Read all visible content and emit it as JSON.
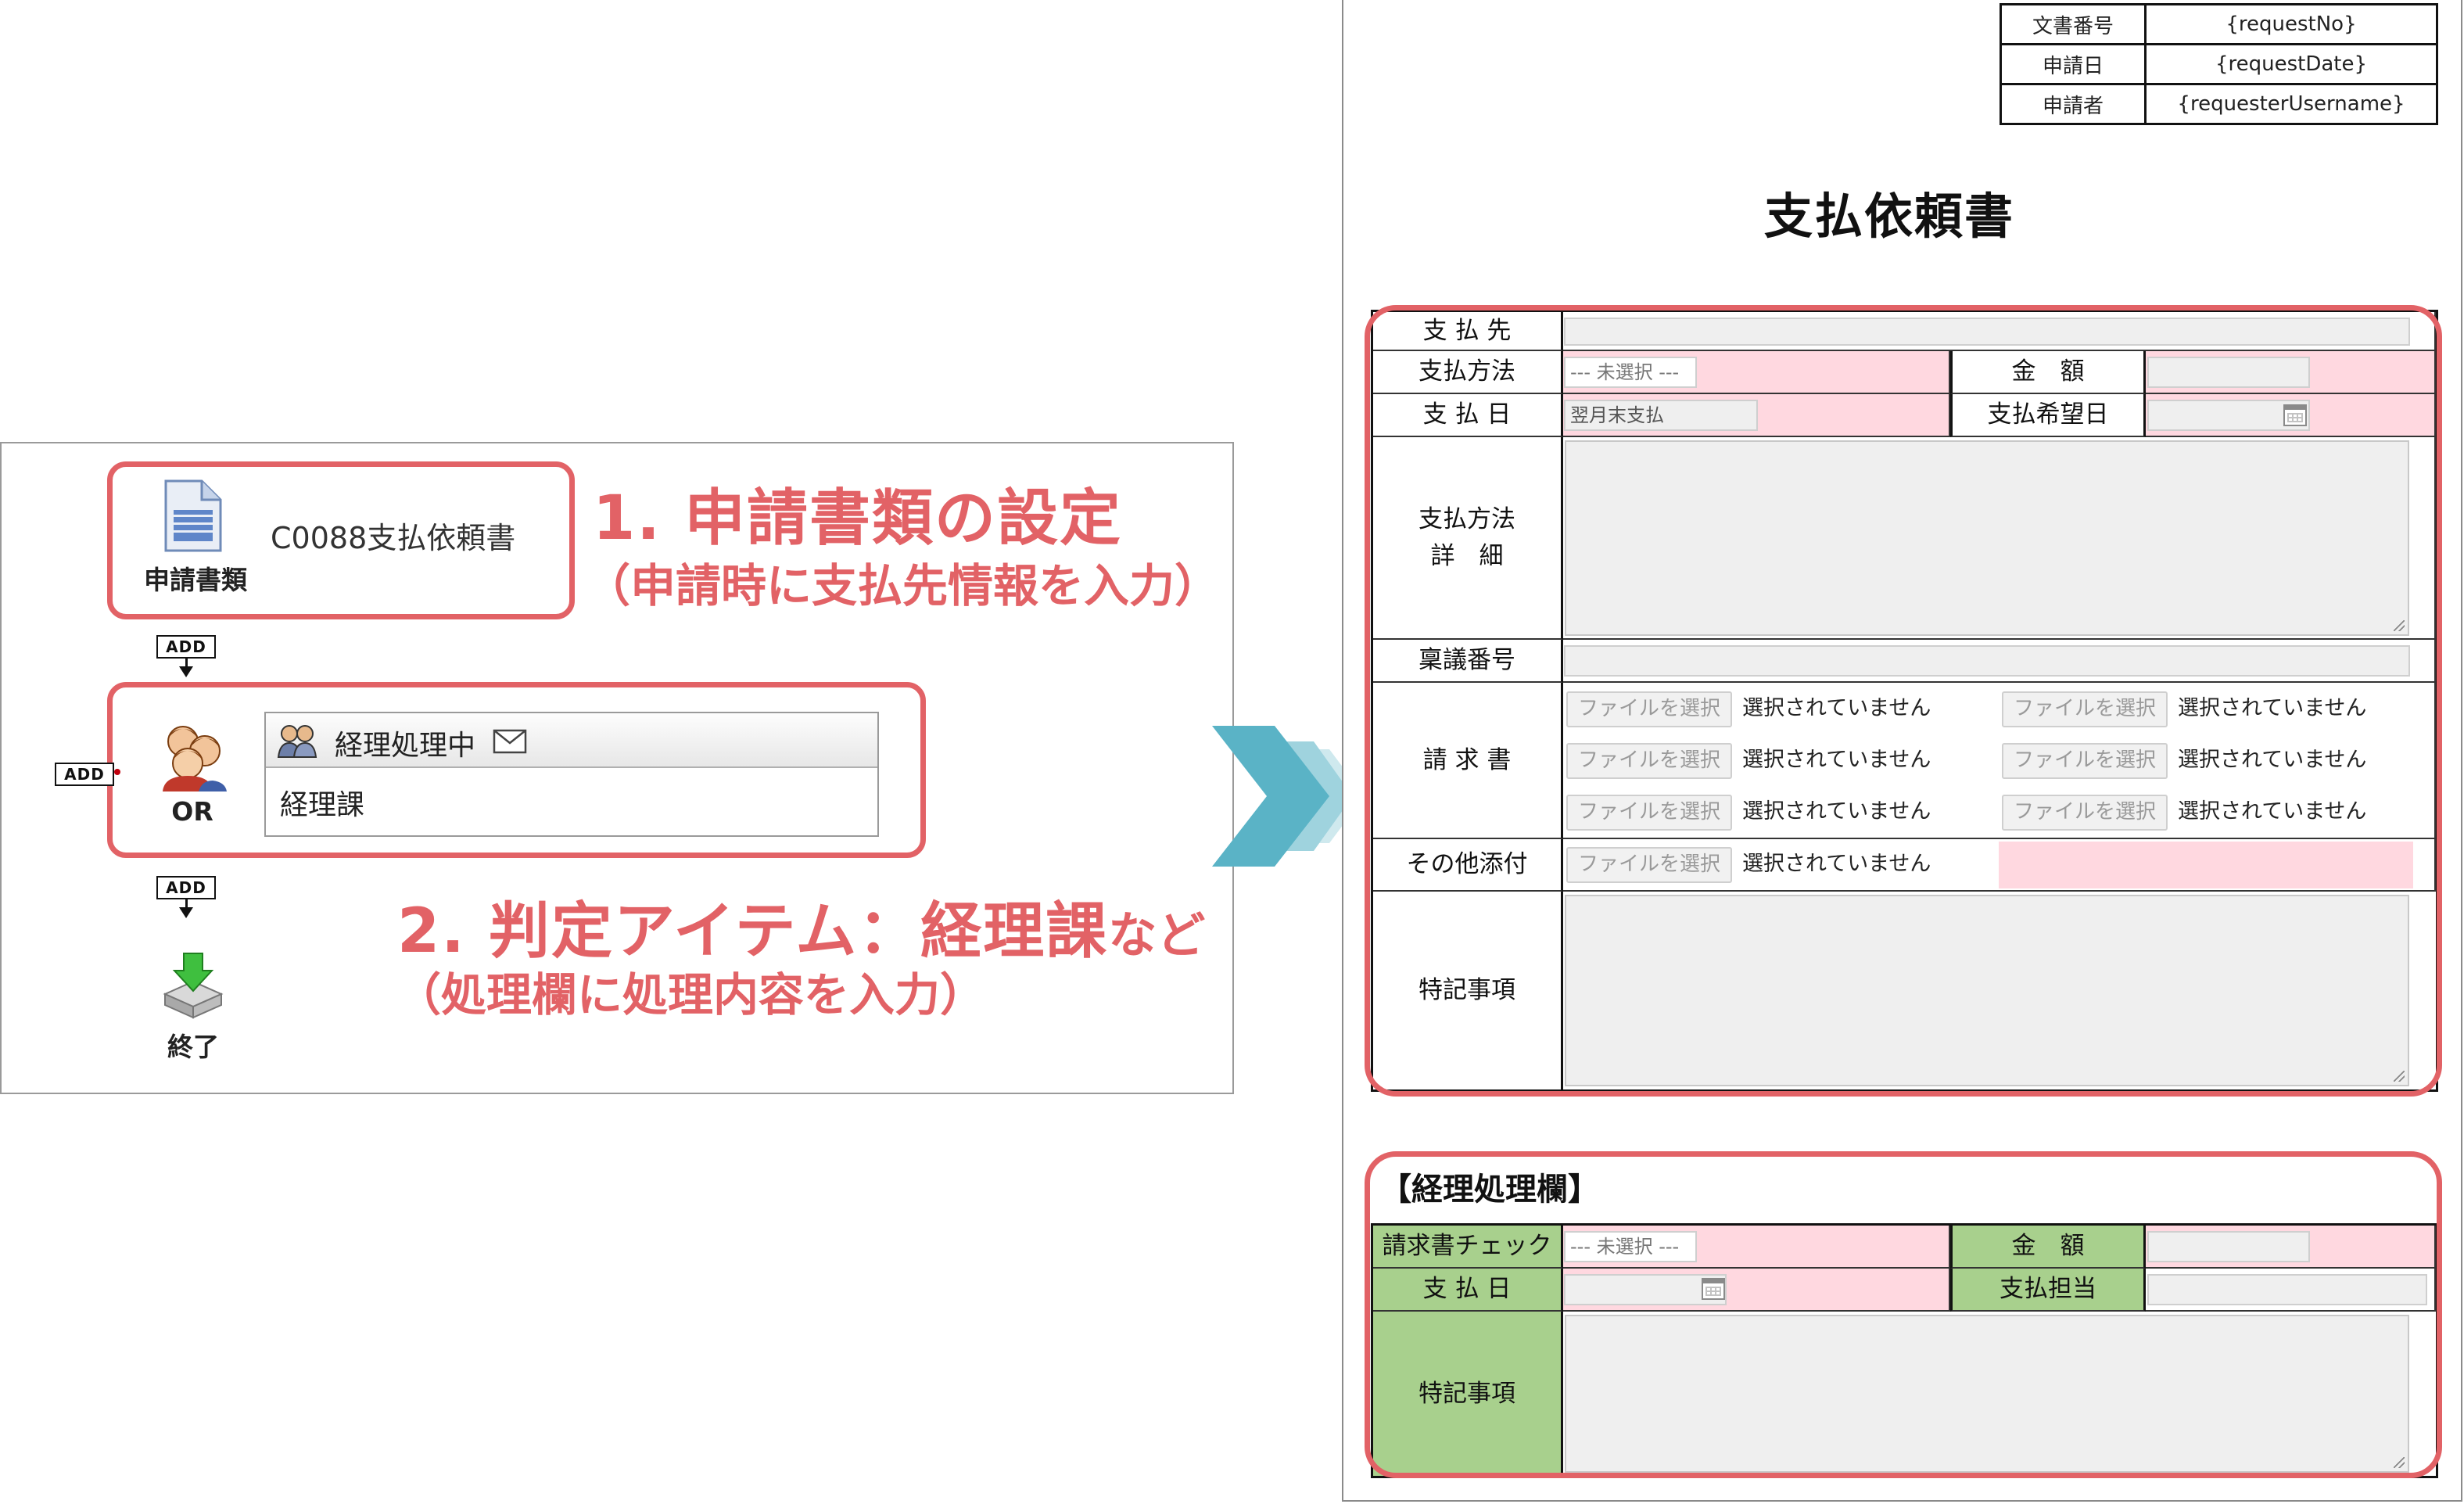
{
  "workflow": {
    "doc_node": {
      "label": "申請書類",
      "name": "C0088支払依頼書"
    },
    "add_label": "ADD",
    "judge_node": {
      "label": "OR",
      "title": "経理処理中",
      "item": "経理課"
    },
    "end_node": {
      "label": "終了"
    },
    "annotation1": {
      "title": "1. 申請書類の設定",
      "sub": "（申請時に支払先情報を入力）"
    },
    "annotation2": {
      "title": "2. 判定アイテム：経理課",
      "suffix": "など",
      "sub": "（処理欄に処理内容を入力）"
    },
    "highlight_color": "#e26266"
  },
  "document": {
    "meta": [
      {
        "key": "文書番号",
        "value": "{requestNo}"
      },
      {
        "key": "申請日",
        "value": "{requestDate}"
      },
      {
        "key": "申請者",
        "value": "{requesterUsername}"
      }
    ],
    "title": "支払依頼書",
    "form": {
      "payee_label": "支 払 先",
      "method_label": "支払方法",
      "method_select": "--- 未選択 ---",
      "amount_label": "金　額",
      "date_label": "支 払 日",
      "date_value": "翌月末支払",
      "desired_date_label": "支払希望日",
      "detail_label_1": "支払方法",
      "detail_label_2": "詳　細",
      "ringi_label": "稟議番号",
      "invoice_label": "請 求 書",
      "other_label": "その他添付",
      "notes_label": "特記事項",
      "file_button": "ファイルを選択",
      "file_none": "選択されていません"
    },
    "accounting": {
      "heading": "【経理処理欄】",
      "check_label": "請求書チェック",
      "check_select": "--- 未選択 ---",
      "amount_label": "金　額",
      "date_label": "支 払 日",
      "person_label": "支払担当",
      "notes_label": "特記事項"
    },
    "colors": {
      "required": "#ffd8e0",
      "label_green": "#a8d08d",
      "chevron": "#5ab3c6"
    }
  }
}
